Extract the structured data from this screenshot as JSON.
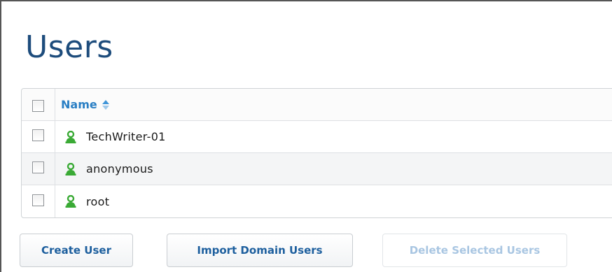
{
  "page": {
    "title": "Users"
  },
  "table": {
    "columns": [
      {
        "label": "Name",
        "sort": "ascending"
      }
    ],
    "rows": [
      {
        "name": "TechWriter-01"
      },
      {
        "name": "anonymous"
      },
      {
        "name": "root"
      }
    ]
  },
  "actions": {
    "create_label": "Create User",
    "import_label": "Import Domain Users",
    "delete_label": "Delete Selected Users",
    "delete_enabled": false
  },
  "icons": {
    "user": "user-icon",
    "sort": "sort-ascending-icon"
  },
  "colors": {
    "title": "#1d4c7c",
    "link": "#2a7fc4",
    "user_icon": "#3aaa35",
    "button_text": "#1d5f9e",
    "disabled_text": "#a9c6e2"
  }
}
